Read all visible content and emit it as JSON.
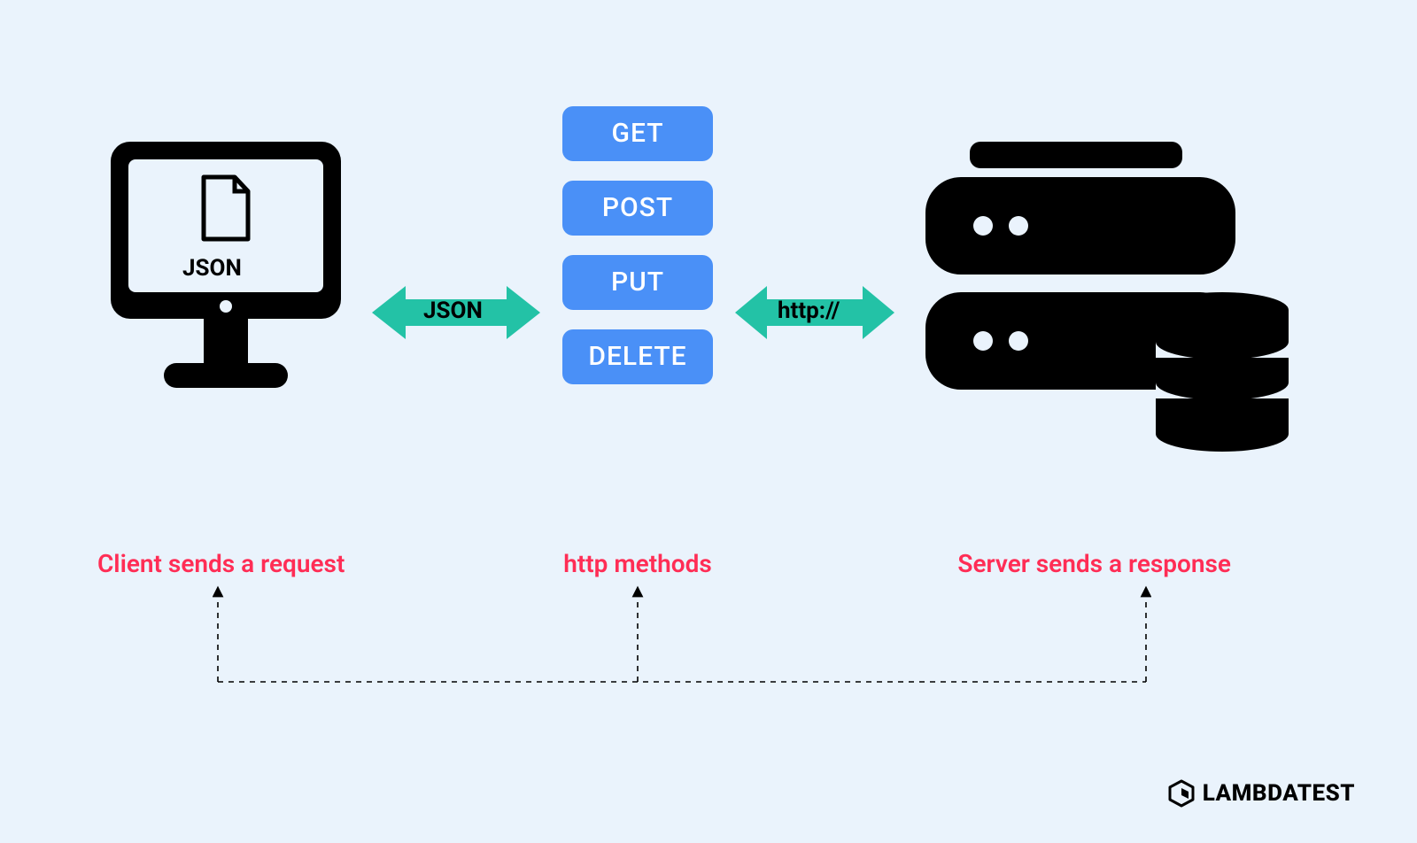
{
  "client": {
    "json_label": "JSON",
    "caption": "Client sends a request"
  },
  "arrows": {
    "left_label": "JSON",
    "right_label": "http://"
  },
  "methods": {
    "items": [
      "GET",
      "POST",
      "PUT",
      "DELETE"
    ],
    "caption": "http methods"
  },
  "server": {
    "caption": "Server sends a response"
  },
  "brand": {
    "name": "LAMBDATEST"
  },
  "colors": {
    "bg": "#EAF3FC",
    "pill": "#4A90F7",
    "arrow": "#23C2A6",
    "caption": "#ff2d55"
  }
}
